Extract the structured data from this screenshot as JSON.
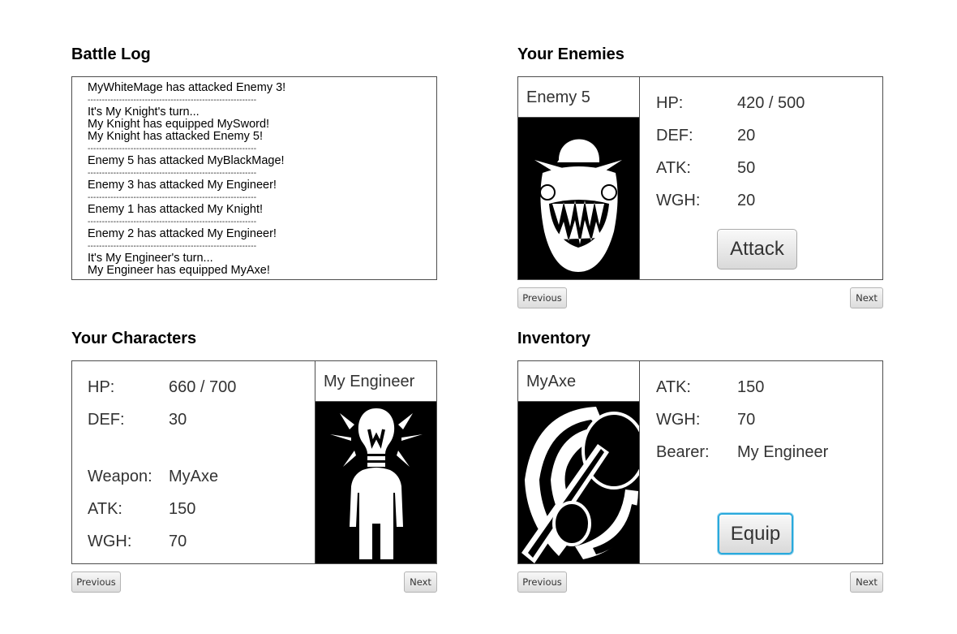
{
  "battle_log": {
    "title": "Battle Log",
    "lines": [
      {
        "text": "MyWhiteMage has attacked Enemy 3!",
        "sep": false
      },
      {
        "text": "-----------------------------------------------------------",
        "sep": true
      },
      {
        "text": "It's My Knight's turn...",
        "sep": false
      },
      {
        "text": "My Knight has equipped MySword!",
        "sep": false
      },
      {
        "text": "My Knight has attacked Enemy 5!",
        "sep": false
      },
      {
        "text": "-----------------------------------------------------------",
        "sep": true
      },
      {
        "text": "Enemy 5 has attacked MyBlackMage!",
        "sep": false
      },
      {
        "text": "-----------------------------------------------------------",
        "sep": true
      },
      {
        "text": "Enemy 3 has attacked My Engineer!",
        "sep": false
      },
      {
        "text": "-----------------------------------------------------------",
        "sep": true
      },
      {
        "text": "Enemy 1 has attacked My Knight!",
        "sep": false
      },
      {
        "text": "-----------------------------------------------------------",
        "sep": true
      },
      {
        "text": "Enemy 2 has attacked My Engineer!",
        "sep": false
      },
      {
        "text": "-----------------------------------------------------------",
        "sep": true
      },
      {
        "text": "It's My Engineer's turn...",
        "sep": false
      },
      {
        "text": "My Engineer has equipped MyAxe!",
        "sep": false
      }
    ]
  },
  "enemies": {
    "title": "Your Enemies",
    "name": "Enemy 5",
    "portrait_icon": "monster-face-icon",
    "hp_label": "HP:",
    "hp_value": "420 / 500",
    "def_label": "DEF:",
    "def_value": "20",
    "atk_label": "ATK:",
    "atk_value": "50",
    "wgh_label": "WGH:",
    "wgh_value": "20",
    "attack_button": "Attack",
    "prev_button": "Previous",
    "next_button": "Next"
  },
  "characters": {
    "title": "Your Characters",
    "name": "My Engineer",
    "portrait_icon": "engineer-lightbulb-icon",
    "hp_label": "HP:",
    "hp_value": "660 / 700",
    "def_label": "DEF:",
    "def_value": "30",
    "weapon_label": "Weapon:",
    "weapon_value": "MyAxe",
    "atk_label": "ATK:",
    "atk_value": "150",
    "wgh_label": "WGH:",
    "wgh_value": "70",
    "prev_button": "Previous",
    "next_button": "Next"
  },
  "inventory": {
    "title": "Inventory",
    "name": "MyAxe",
    "portrait_icon": "axe-icon",
    "atk_label": "ATK:",
    "atk_value": "150",
    "wgh_label": "WGH:",
    "wgh_value": "70",
    "bearer_label": "Bearer:",
    "bearer_value": "My Engineer",
    "equip_button": "Equip",
    "prev_button": "Previous",
    "next_button": "Next"
  },
  "colors": {
    "focus_ring": "#29a9dc",
    "border": "#4d4d4d",
    "portrait_bg": "#000000"
  }
}
